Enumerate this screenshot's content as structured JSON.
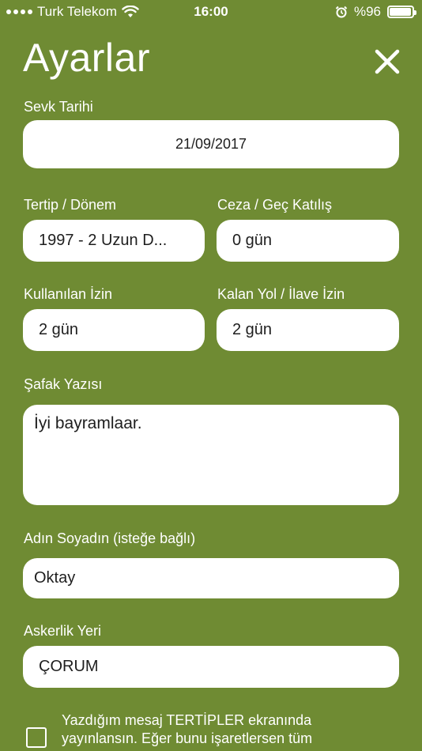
{
  "status_bar": {
    "carrier": "Turk Telekom",
    "time": "16:00",
    "battery_text": "%96",
    "battery_level": 0.96
  },
  "header": {
    "title": "Ayarlar"
  },
  "form": {
    "sevk_tarihi": {
      "label": "Sevk Tarihi",
      "value": "21/09/2017"
    },
    "tertip_donem": {
      "label": "Tertip / Dönem",
      "value": "1997 - 2 Uzun D..."
    },
    "ceza": {
      "label": "Ceza / Geç Katılış",
      "value": "0  gün"
    },
    "kullanilan_izin": {
      "label": "Kullanılan İzin",
      "value": "2  gün"
    },
    "kalan_izin": {
      "label": "Kalan Yol / İlave İzin",
      "value": "2  gün"
    },
    "safak_yazisi": {
      "label": "Şafak Yazısı",
      "value": "İyi bayramlaar."
    },
    "ad_soyad": {
      "label": "Adın Soyadın (isteğe bağlı)",
      "value": "Oktay"
    },
    "askerlik_yeri": {
      "label": "Askerlik Yeri",
      "value": "ÇORUM"
    }
  },
  "publish": {
    "checked": false,
    "text": "Yazdığım mesaj TERTİPLER ekranında yayınlansın. Eğer bunu işaretlersen tüm"
  },
  "icons": {
    "signal": "signal-dots-icon",
    "wifi": "wifi-icon",
    "alarm": "alarm-clock-icon",
    "battery": "battery-icon",
    "close": "close-icon"
  }
}
